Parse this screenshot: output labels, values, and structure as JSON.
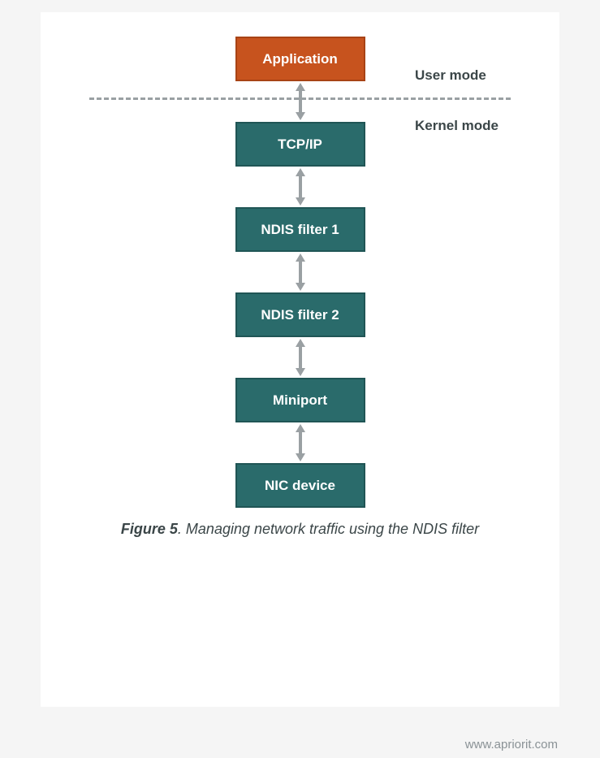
{
  "diagram": {
    "boxes": [
      {
        "label": "Application",
        "color": "orange"
      },
      {
        "label": "TCP/IP",
        "color": "teal"
      },
      {
        "label": "NDIS filter 1",
        "color": "teal"
      },
      {
        "label": "NDIS filter 2",
        "color": "teal"
      },
      {
        "label": "Miniport",
        "color": "teal"
      },
      {
        "label": "NIC device",
        "color": "teal"
      }
    ],
    "modes": {
      "user": "User mode",
      "kernel": "Kernel mode"
    }
  },
  "caption": {
    "figlabel": "Figure 5",
    "text": ". Managing network traffic using the NDIS filter"
  },
  "footer": "www.apriorit.com",
  "colors": {
    "orange": "#c7531e",
    "teal": "#2a6b6b",
    "arrow": "#9aa0a3",
    "text": "#3b4648"
  }
}
